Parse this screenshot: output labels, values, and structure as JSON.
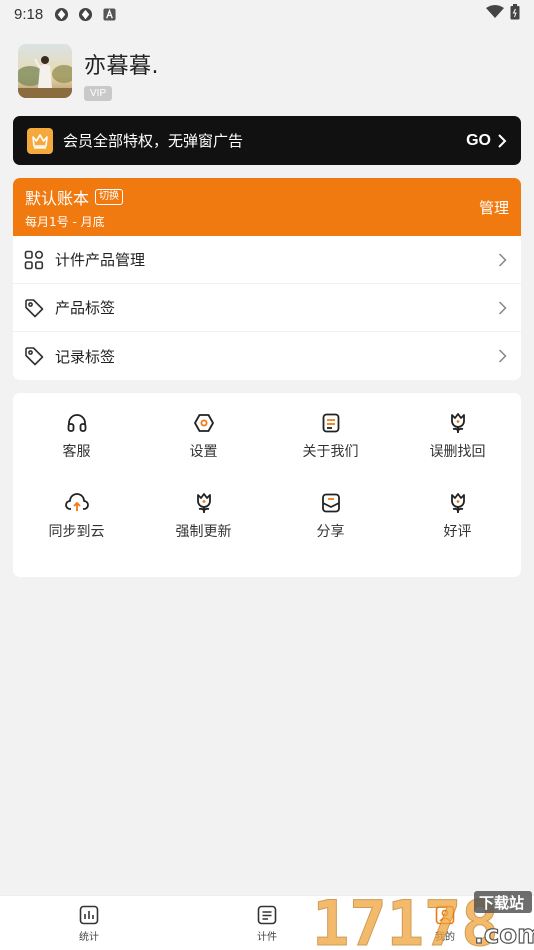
{
  "status_bar": {
    "time": "9:18"
  },
  "profile": {
    "name": "亦暮暮.",
    "badge": "VIP"
  },
  "vip_banner": {
    "text": "会员全部特权，无弹窗广告",
    "go": "GO"
  },
  "account": {
    "title": "默认账本",
    "switch_label": "切换",
    "subtitle": "每月1号 - 月底",
    "manage": "管理",
    "menu": [
      {
        "label": "计件产品管理",
        "icon": "grid-icon"
      },
      {
        "label": "产品标签",
        "icon": "tag-icon"
      },
      {
        "label": "记录标签",
        "icon": "tag-icon"
      }
    ]
  },
  "features": [
    {
      "label": "客服",
      "icon": "headset-icon"
    },
    {
      "label": "设置",
      "icon": "settings-icon"
    },
    {
      "label": "关于我们",
      "icon": "document-icon"
    },
    {
      "label": "误删找回",
      "icon": "flower-icon"
    },
    {
      "label": "同步到云",
      "icon": "cloud-upload-icon"
    },
    {
      "label": "强制更新",
      "icon": "flower-icon"
    },
    {
      "label": "分享",
      "icon": "share-icon"
    },
    {
      "label": "好评",
      "icon": "flower-icon"
    }
  ],
  "bottom_nav": [
    {
      "label": "统计",
      "icon": "bar-chart-icon"
    },
    {
      "label": "计件",
      "icon": "list-icon"
    },
    {
      "label": "我的",
      "icon": "profile-icon"
    }
  ],
  "watermark": {
    "text": "17178",
    "sub_top": "下载站",
    "sub_bottom": ".com"
  },
  "colors": {
    "accent": "#f07a10",
    "banner": "#111111",
    "crown": "#f5a93a",
    "background": "#f2f2f2"
  }
}
